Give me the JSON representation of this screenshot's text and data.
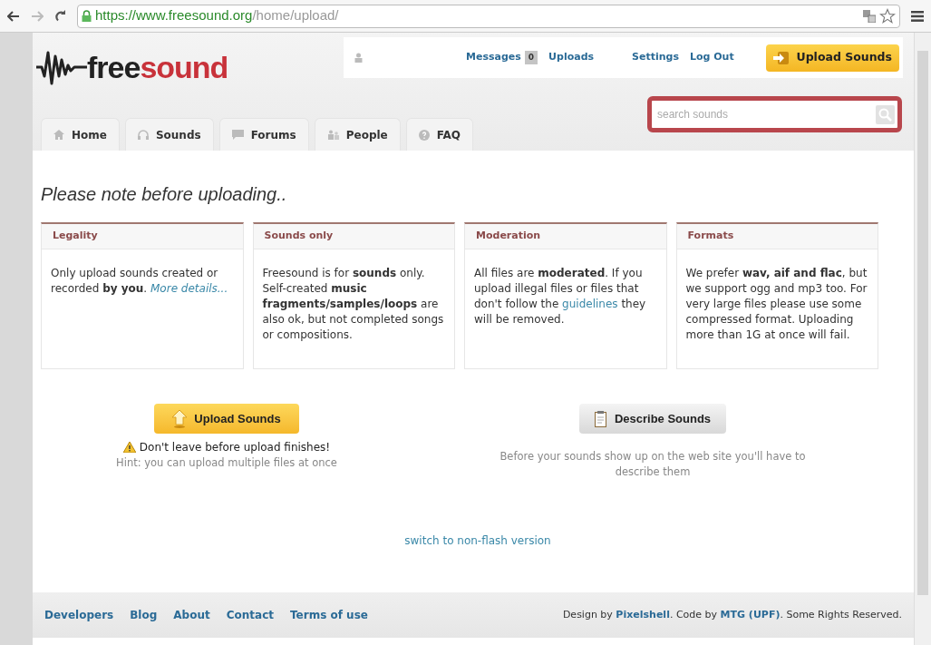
{
  "browser": {
    "url_host": "https://www.freesound.org",
    "url_path": "/home/upload/"
  },
  "user_bar": {
    "messages": "Messages",
    "messages_count": "0",
    "links": [
      "Uploads",
      "Settings",
      "Log Out"
    ],
    "upload_button": "Upload Sounds"
  },
  "logo": {
    "part_dark": "free",
    "part_red": "sound"
  },
  "tabs": [
    {
      "label": "Home",
      "kind": "home"
    },
    {
      "label": "Sounds",
      "kind": "sounds"
    },
    {
      "label": "Forums",
      "kind": "forums"
    },
    {
      "label": "People",
      "kind": "people"
    },
    {
      "label": "FAQ",
      "kind": "faq"
    }
  ],
  "search": {
    "placeholder": "search sounds"
  },
  "heading": "Please note before uploading..",
  "cards": [
    {
      "title": "Legality",
      "body": [
        {
          "kind": "text",
          "text": "Only upload sounds created or recorded **by you**. "
        },
        {
          "kind": "note_link",
          "text": "More details..."
        }
      ]
    },
    {
      "title": "Sounds only",
      "body": [
        {
          "kind": "text",
          "text": "Freesound is for **sounds** only. Self-created **music fragments/samples/loops** are also ok, but not completed songs or compositions."
        }
      ]
    },
    {
      "title": "Moderation",
      "body": [
        {
          "kind": "text",
          "text": "All files are **moderated**. If you upload illegal files or files that don't follow the "
        },
        {
          "kind": "link",
          "text": "guidelines"
        },
        {
          "kind": "text",
          "text": " they will be removed."
        }
      ]
    },
    {
      "title": "Formats",
      "body": [
        {
          "kind": "text",
          "text": "We prefer **wav, aif and flac**, but we support ogg and mp3 too. For very large files please use some compressed format. Uploading more than 1G at once will fail."
        }
      ]
    }
  ],
  "upload": {
    "button": "Upload Sounds",
    "warning": "Don't leave before upload finishes!",
    "hint": "Hint: you can upload multiple files at once"
  },
  "describe": {
    "button": "Describe Sounds",
    "hint": "Before your sounds show up on the web site you'll have to describe them"
  },
  "switch_link": "switch to non-flash version",
  "footer": {
    "links": [
      "Developers",
      "Blog",
      "About",
      "Contact",
      "Terms of use"
    ],
    "credits": [
      {
        "kind": "text",
        "text": "Design by "
      },
      {
        "kind": "link",
        "text": "Pixelshell"
      },
      {
        "kind": "text",
        "text": ". Code by "
      },
      {
        "kind": "link",
        "text": "MTG (UPF)"
      },
      {
        "kind": "text",
        "text": ". Some Rights Reserved."
      }
    ]
  }
}
